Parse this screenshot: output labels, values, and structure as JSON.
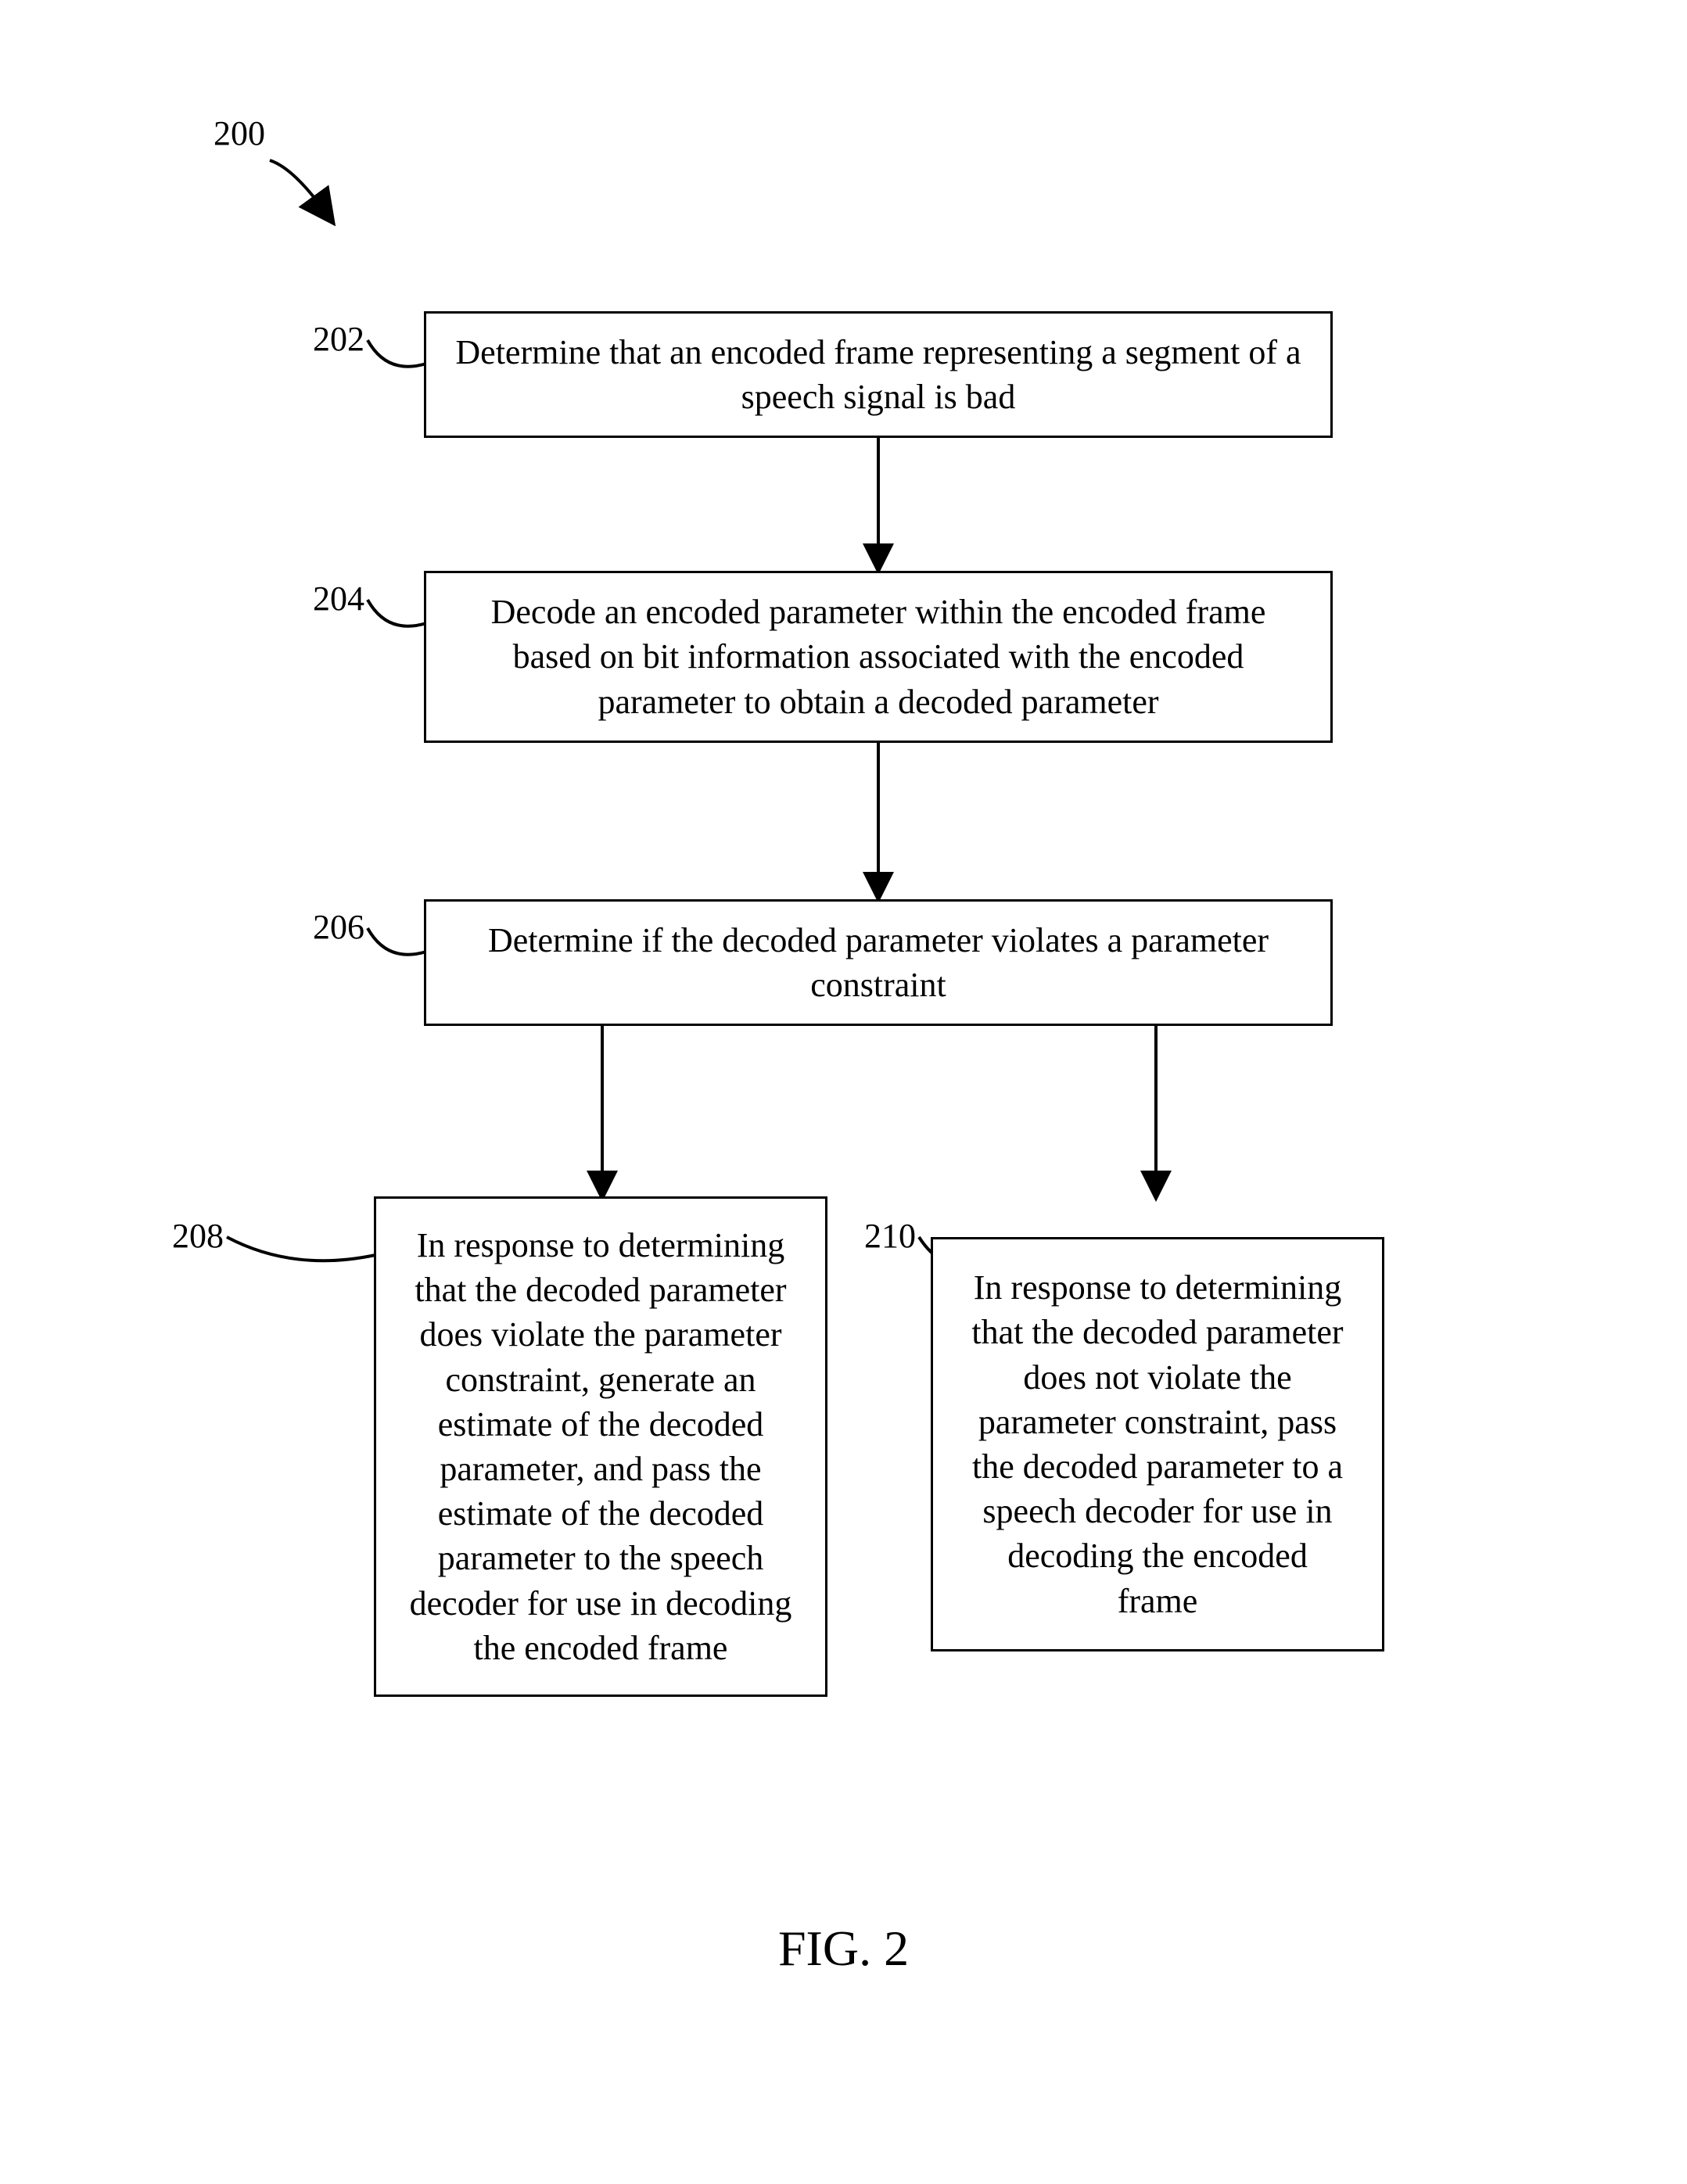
{
  "figure": {
    "number_label": "200",
    "title": "FIG. 2"
  },
  "nodes": {
    "n202": {
      "ref": "202",
      "text": "Determine that an encoded frame representing a segment of a speech signal is bad"
    },
    "n204": {
      "ref": "204",
      "text": "Decode an encoded parameter within the encoded frame based on bit information associated with the encoded parameter to obtain a decoded parameter"
    },
    "n206": {
      "ref": "206",
      "text": "Determine if the decoded parameter violates a parameter constraint"
    },
    "n208": {
      "ref": "208",
      "text": "In response to determining that the decoded parameter does violate the parameter constraint, generate an estimate of the decoded parameter, and pass the estimate of the decoded parameter to the speech decoder for use in decoding the encoded frame"
    },
    "n210": {
      "ref": "210",
      "text": "In response to determining that the decoded parameter does not violate the parameter constraint, pass the decoded parameter to a speech decoder for use in decoding the encoded frame"
    }
  }
}
